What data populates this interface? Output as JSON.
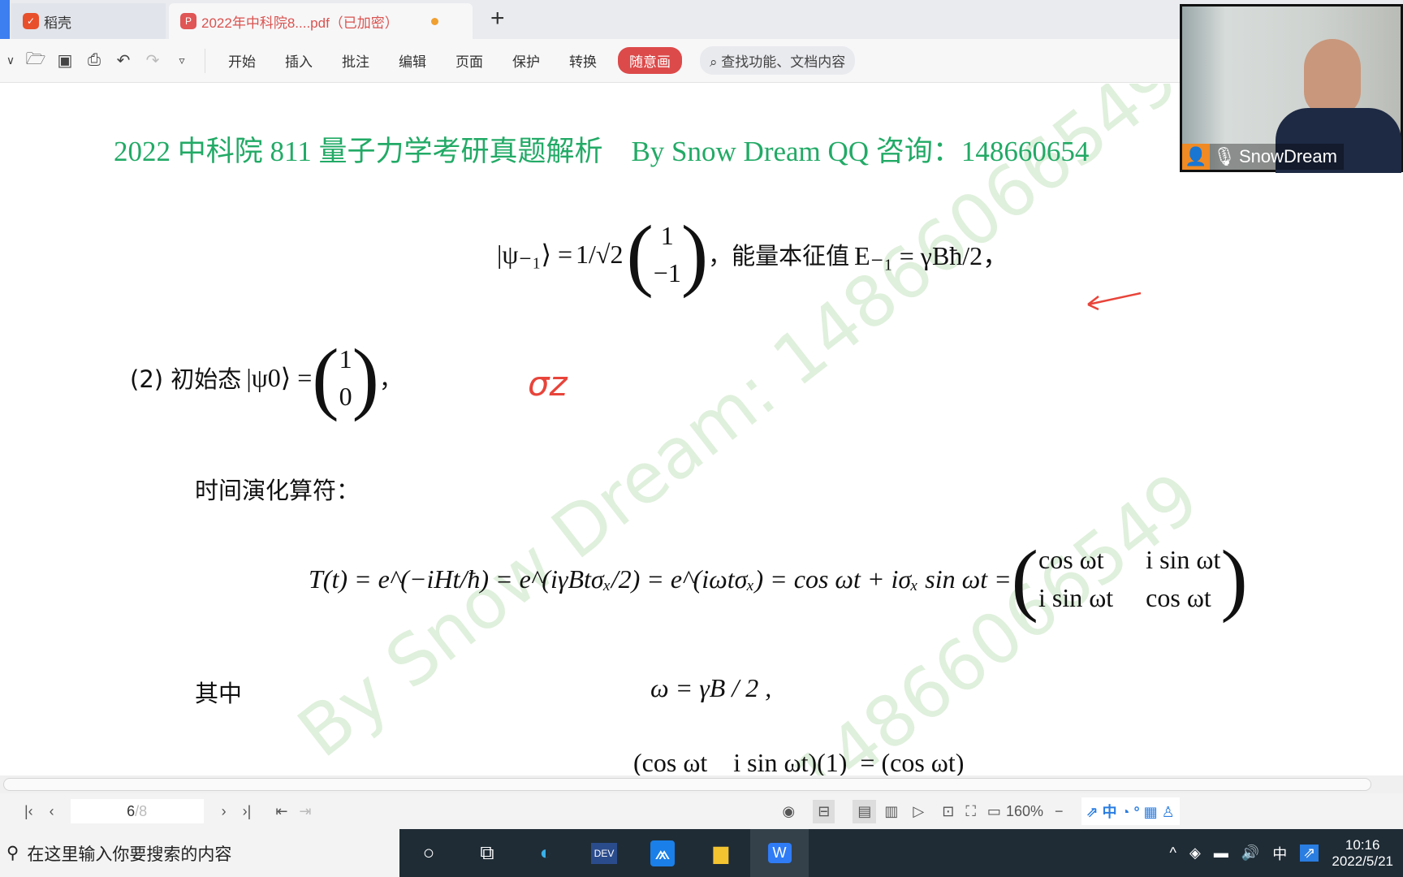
{
  "tabs": [
    {
      "label": "稻壳",
      "icon": "daoke-logo"
    },
    {
      "label": "2022年中科院8....pdf（已加密）",
      "icon": "pdf-icon",
      "modified_dot_color": "#f0a030"
    }
  ],
  "new_tab": "+",
  "toolbar": {
    "menus": [
      "开始",
      "插入",
      "批注",
      "编辑",
      "页面",
      "保护",
      "转换"
    ],
    "scribble": "随意画",
    "search_placeholder": "查找功能、文档内容",
    "accent": "#dc4a4a"
  },
  "document": {
    "header": "2022 中科院 811 量子力学考研真题解析    By Snow Dream QQ 咨询：148660654",
    "eq1_left": "|ψ₋₁⟩ = ",
    "eq1_frac": "1/√2",
    "eq1_vec": [
      "1",
      "−1"
    ],
    "eq1_text": "，能量本征值",
    "eq1_right": "E₋₁ = γBħ/2，",
    "item2_label": "(2) 初始态",
    "item2_state": "|ψ0⟩ =",
    "item2_vec": [
      "1",
      "0"
    ],
    "handwriting": "σz",
    "evolution_label": "时间演化算符：",
    "eq2": "T(t) = e^(−iHt/ħ) = e^(iγBtσₓ/2) = e^(iωtσₓ) = cos ωt + iσₓ sin ωt =",
    "eq2_matrix": [
      [
        "cos ωt",
        "i sin ωt"
      ],
      [
        "i sin ωt",
        "cos ωt"
      ]
    ],
    "where_label": "其中",
    "omega": "ω = γB / 2 ,",
    "partial_line": "(cos ωt    i sin ωt)(1)  = (cos ωt)",
    "watermark1": "By Snow Dream: 14866066549",
    "watermark2": "14866066549"
  },
  "webcam": {
    "name": "SnowDream"
  },
  "status": {
    "page_current": "6",
    "page_total": "/8",
    "zoom": "160%"
  },
  "taskbar": {
    "search_placeholder": "在这里输入你要搜索的内容",
    "time": "10:16",
    "date": "2022/5/21",
    "ime": "中"
  }
}
